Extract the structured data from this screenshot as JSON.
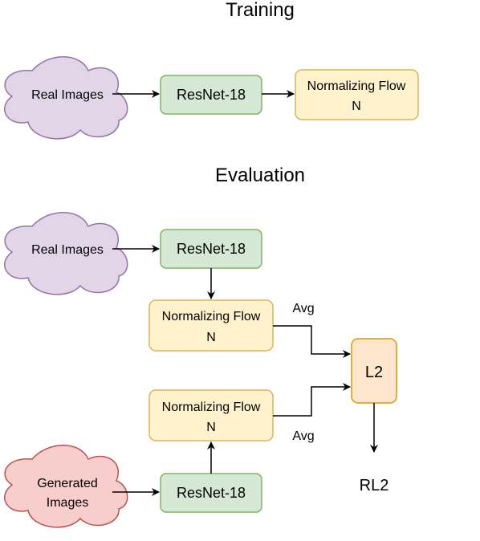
{
  "sections": {
    "training": {
      "title": "Training"
    },
    "evaluation": {
      "title": "Evaluation"
    }
  },
  "training": {
    "real_images": {
      "label": "Real Images"
    },
    "resnet": {
      "label": "ResNet-18"
    },
    "flow": {
      "line1": "Normalizing Flow",
      "line2": "N"
    }
  },
  "evaluation": {
    "real_images": {
      "label": "Real Images"
    },
    "resnet_real": {
      "label": "ResNet-18"
    },
    "flow_real": {
      "line1": "Normalizing Flow",
      "line2": "N"
    },
    "generated_images": {
      "line1": "Generated",
      "line2": "Images"
    },
    "resnet_gen": {
      "label": "ResNet-18"
    },
    "flow_gen": {
      "line1": "Normalizing Flow",
      "line2": "N"
    },
    "avg_top": "Avg",
    "avg_bottom": "Avg",
    "l2": {
      "label": "L2"
    },
    "output": {
      "label": "RL2"
    }
  },
  "colors": {
    "purple_fill": "#e1d5e7",
    "purple_stroke": "#9673a6",
    "green_fill": "#d5e8d4",
    "green_stroke": "#82b366",
    "yellow_fill": "#fff2cc",
    "yellow_stroke": "#d6b656",
    "orange_fill": "#ffe6cc",
    "orange_stroke": "#d79b00",
    "red_fill": "#f8cecc",
    "red_stroke": "#b85450"
  }
}
